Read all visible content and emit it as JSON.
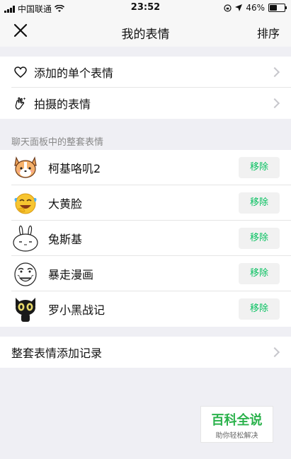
{
  "status": {
    "carrier": "中国联通",
    "time": "23:52",
    "battery": "46%",
    "battery_level": 0.46
  },
  "nav": {
    "title": "我的表情",
    "sort_label": "排序"
  },
  "quick_items": [
    {
      "label": "添加的单个表情",
      "icon": "heart-icon"
    },
    {
      "label": "拍摄的表情",
      "icon": "hand-sparkle-icon"
    }
  ],
  "section_label": "聊天面板中的整套表情",
  "packs": [
    {
      "name": "柯基咯叽2",
      "icon": "corgi-sticker-icon",
      "action": "移除"
    },
    {
      "name": "大黄脸",
      "icon": "laughing-emoji-icon",
      "action": "移除"
    },
    {
      "name": "兔斯基",
      "icon": "tuzki-sticker-icon",
      "action": "移除"
    },
    {
      "name": "暴走漫画",
      "icon": "rage-comic-icon",
      "action": "移除"
    },
    {
      "name": "罗小黑战记",
      "icon": "black-cat-icon",
      "action": "移除"
    }
  ],
  "history_label": "整套表情添加记录",
  "watermark": {
    "title": "百科全说",
    "subtitle": "助你轻松解决"
  },
  "colors": {
    "accent": "#07c160",
    "background": "#efeff4",
    "watermark_green": "#2bb24c"
  }
}
